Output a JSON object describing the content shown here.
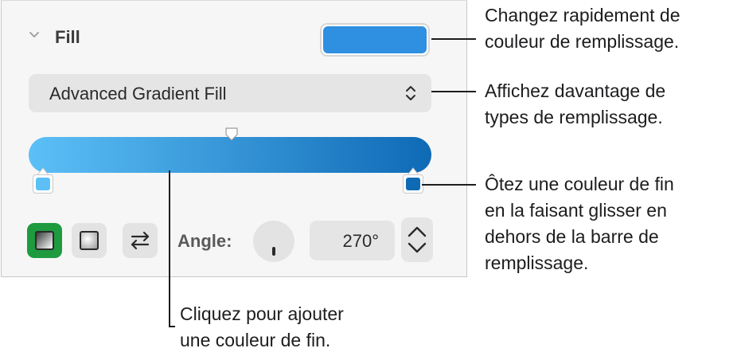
{
  "panel": {
    "section_title": "Fill",
    "fill_type_select": "Advanced Gradient Fill",
    "angle_label": "Angle:",
    "angle_value": "270°",
    "colors": {
      "well": "#2f8fe0",
      "gradient_start": "#5cc0f7",
      "gradient_end": "#0f6ab6",
      "linear_selected_bg": "#1e9a3f"
    },
    "icons": {
      "collapse": "chevron-down-icon",
      "select": "up-down-arrows-icon",
      "linear": "linear-gradient-icon",
      "radial": "radial-gradient-icon",
      "swap": "swap-arrows-icon",
      "stepper": "up-down-stepper-icon"
    }
  },
  "callouts": {
    "quick_color": [
      "Changez rapidement de",
      "couleur de remplissage."
    ],
    "more_types": [
      "Affichez davantage de",
      "types de remplissage."
    ],
    "remove_stop": [
      "Ôtez une couleur de fin",
      "en la faisant glisser en",
      "dehors de la barre de",
      "remplissage."
    ],
    "add_stop": [
      "Cliquez pour ajouter",
      "une couleur de fin."
    ]
  }
}
